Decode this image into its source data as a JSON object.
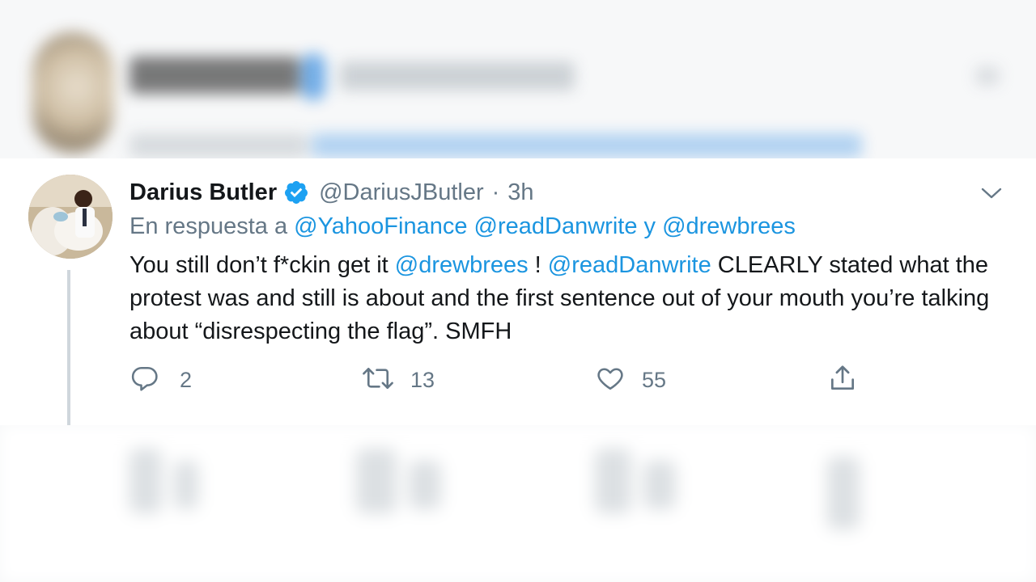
{
  "tweet": {
    "author_name": "Darius Butler",
    "handle": "@DariusJButler",
    "separator": "·",
    "time": "3h",
    "reply_prefix": "En respuesta a",
    "reply_to_1": "@YahooFinance",
    "reply_to_2": "@readDanwrite",
    "reply_conjunction": "y",
    "reply_to_3": "@drewbrees",
    "text_part_1": "You still don’t f*ckin get it ",
    "mention_1": "@drewbrees",
    "text_part_2": " ! ",
    "mention_2": "@readDanwrite",
    "text_part_3": " CLEARLY stated what the protest was and still is about and the first sentence out of your mouth you’re talking about “disrespecting the flag”. SMFH"
  },
  "actions": {
    "replies": "2",
    "retweets": "13",
    "likes": "55"
  },
  "icons": {
    "verified": "verified-badge-icon",
    "more": "chevron-down-icon",
    "reply": "reply-icon",
    "retweet": "retweet-icon",
    "like": "heart-icon",
    "share": "share-icon"
  },
  "colors": {
    "link": "#1b95e0",
    "secondary_text": "#657786",
    "primary_text": "#14171a",
    "verified": "#1da1f2"
  }
}
